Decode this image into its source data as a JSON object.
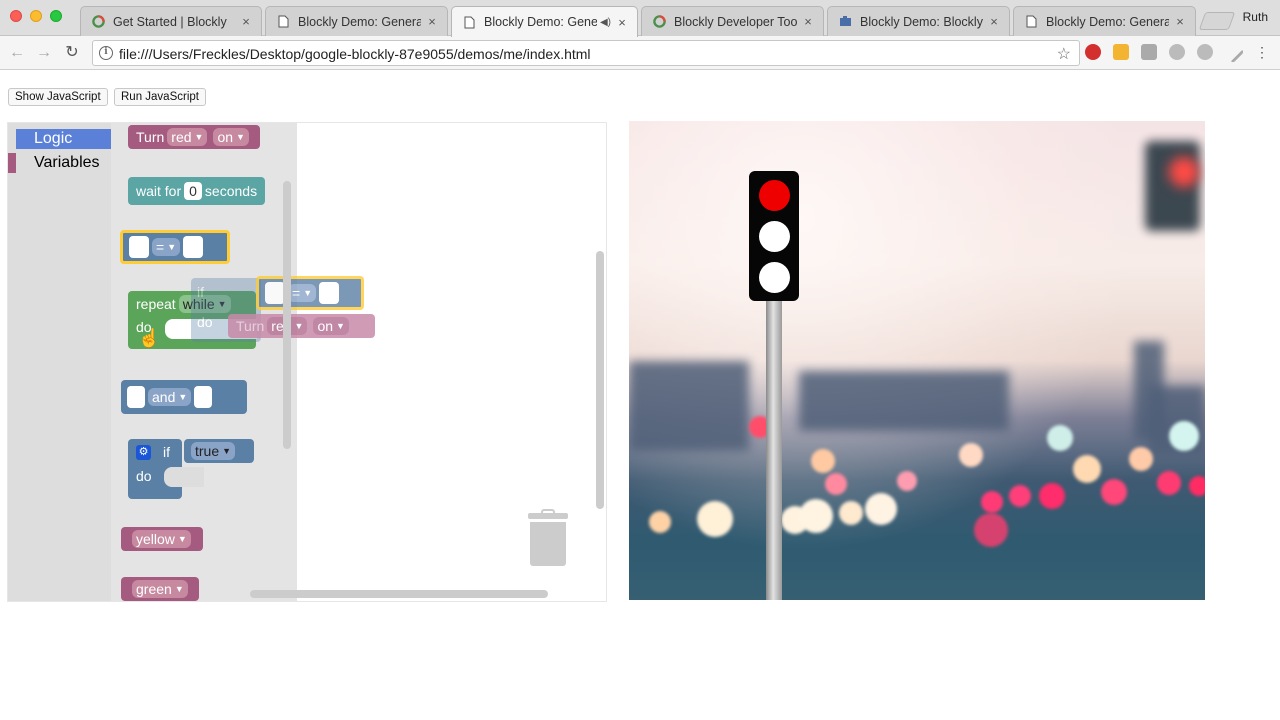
{
  "browser": {
    "tabs": [
      {
        "title": "Get Started  |  Blockly",
        "favicon": "blockly-logo-icon"
      },
      {
        "title": "Blockly Demo: Generat",
        "favicon": "document-icon"
      },
      {
        "title": "Blockly Demo: Gene",
        "favicon": "document-icon",
        "active": true
      },
      {
        "title": "Blockly Developer Tool",
        "favicon": "blockly-logo-icon"
      },
      {
        "title": "Blockly Demo: Blockly",
        "favicon": "puzzle-icon"
      },
      {
        "title": "Blockly Demo: Generat",
        "favicon": "document-icon"
      }
    ],
    "profile_name": "Ruth",
    "url": "file:///Users/Freckles/Desktop/google-blockly-87e9055/demos/me/index.html",
    "close_glyph": "×"
  },
  "page": {
    "show_js_label": "Show JavaScript",
    "run_js_label": "Run JavaScript"
  },
  "toolbox": {
    "categories": [
      {
        "label": "Logic",
        "selected": true,
        "color": "#5b80d8"
      },
      {
        "label": "Variables",
        "selected": false,
        "color": "#a55b80"
      }
    ]
  },
  "flyout": {
    "turn_block": {
      "label": "Turn",
      "color_field": "red",
      "state_field": "on"
    },
    "wait_block": {
      "prefix": "wait for",
      "value": "0",
      "suffix": "seconds"
    },
    "compare_block": {
      "operator": "="
    },
    "repeat_block": {
      "label": "repeat",
      "mode": "while",
      "do_label": "do"
    },
    "and_block": {
      "operator": "and"
    },
    "if_block": {
      "label": "if",
      "value": "true",
      "do_label": "do"
    },
    "yellow_block": {
      "label": "yellow"
    },
    "green_block": {
      "label": "green"
    }
  },
  "dragging": {
    "if_label": "if",
    "operator": "=",
    "do_label": "do",
    "turn_label": "Turn",
    "color_field": "red",
    "state_field": "on"
  },
  "traffic_light": {
    "lamps": [
      {
        "state": "on",
        "color": "#ef0000"
      },
      {
        "state": "off",
        "color": "#ffffff"
      },
      {
        "state": "off",
        "color": "#ffffff"
      }
    ]
  },
  "colors": {
    "logic": "#5b80a5",
    "loops": "#5ba55b",
    "lights": "#a55b80",
    "wait": "#5ba5a5",
    "highlight": "#fc3"
  }
}
